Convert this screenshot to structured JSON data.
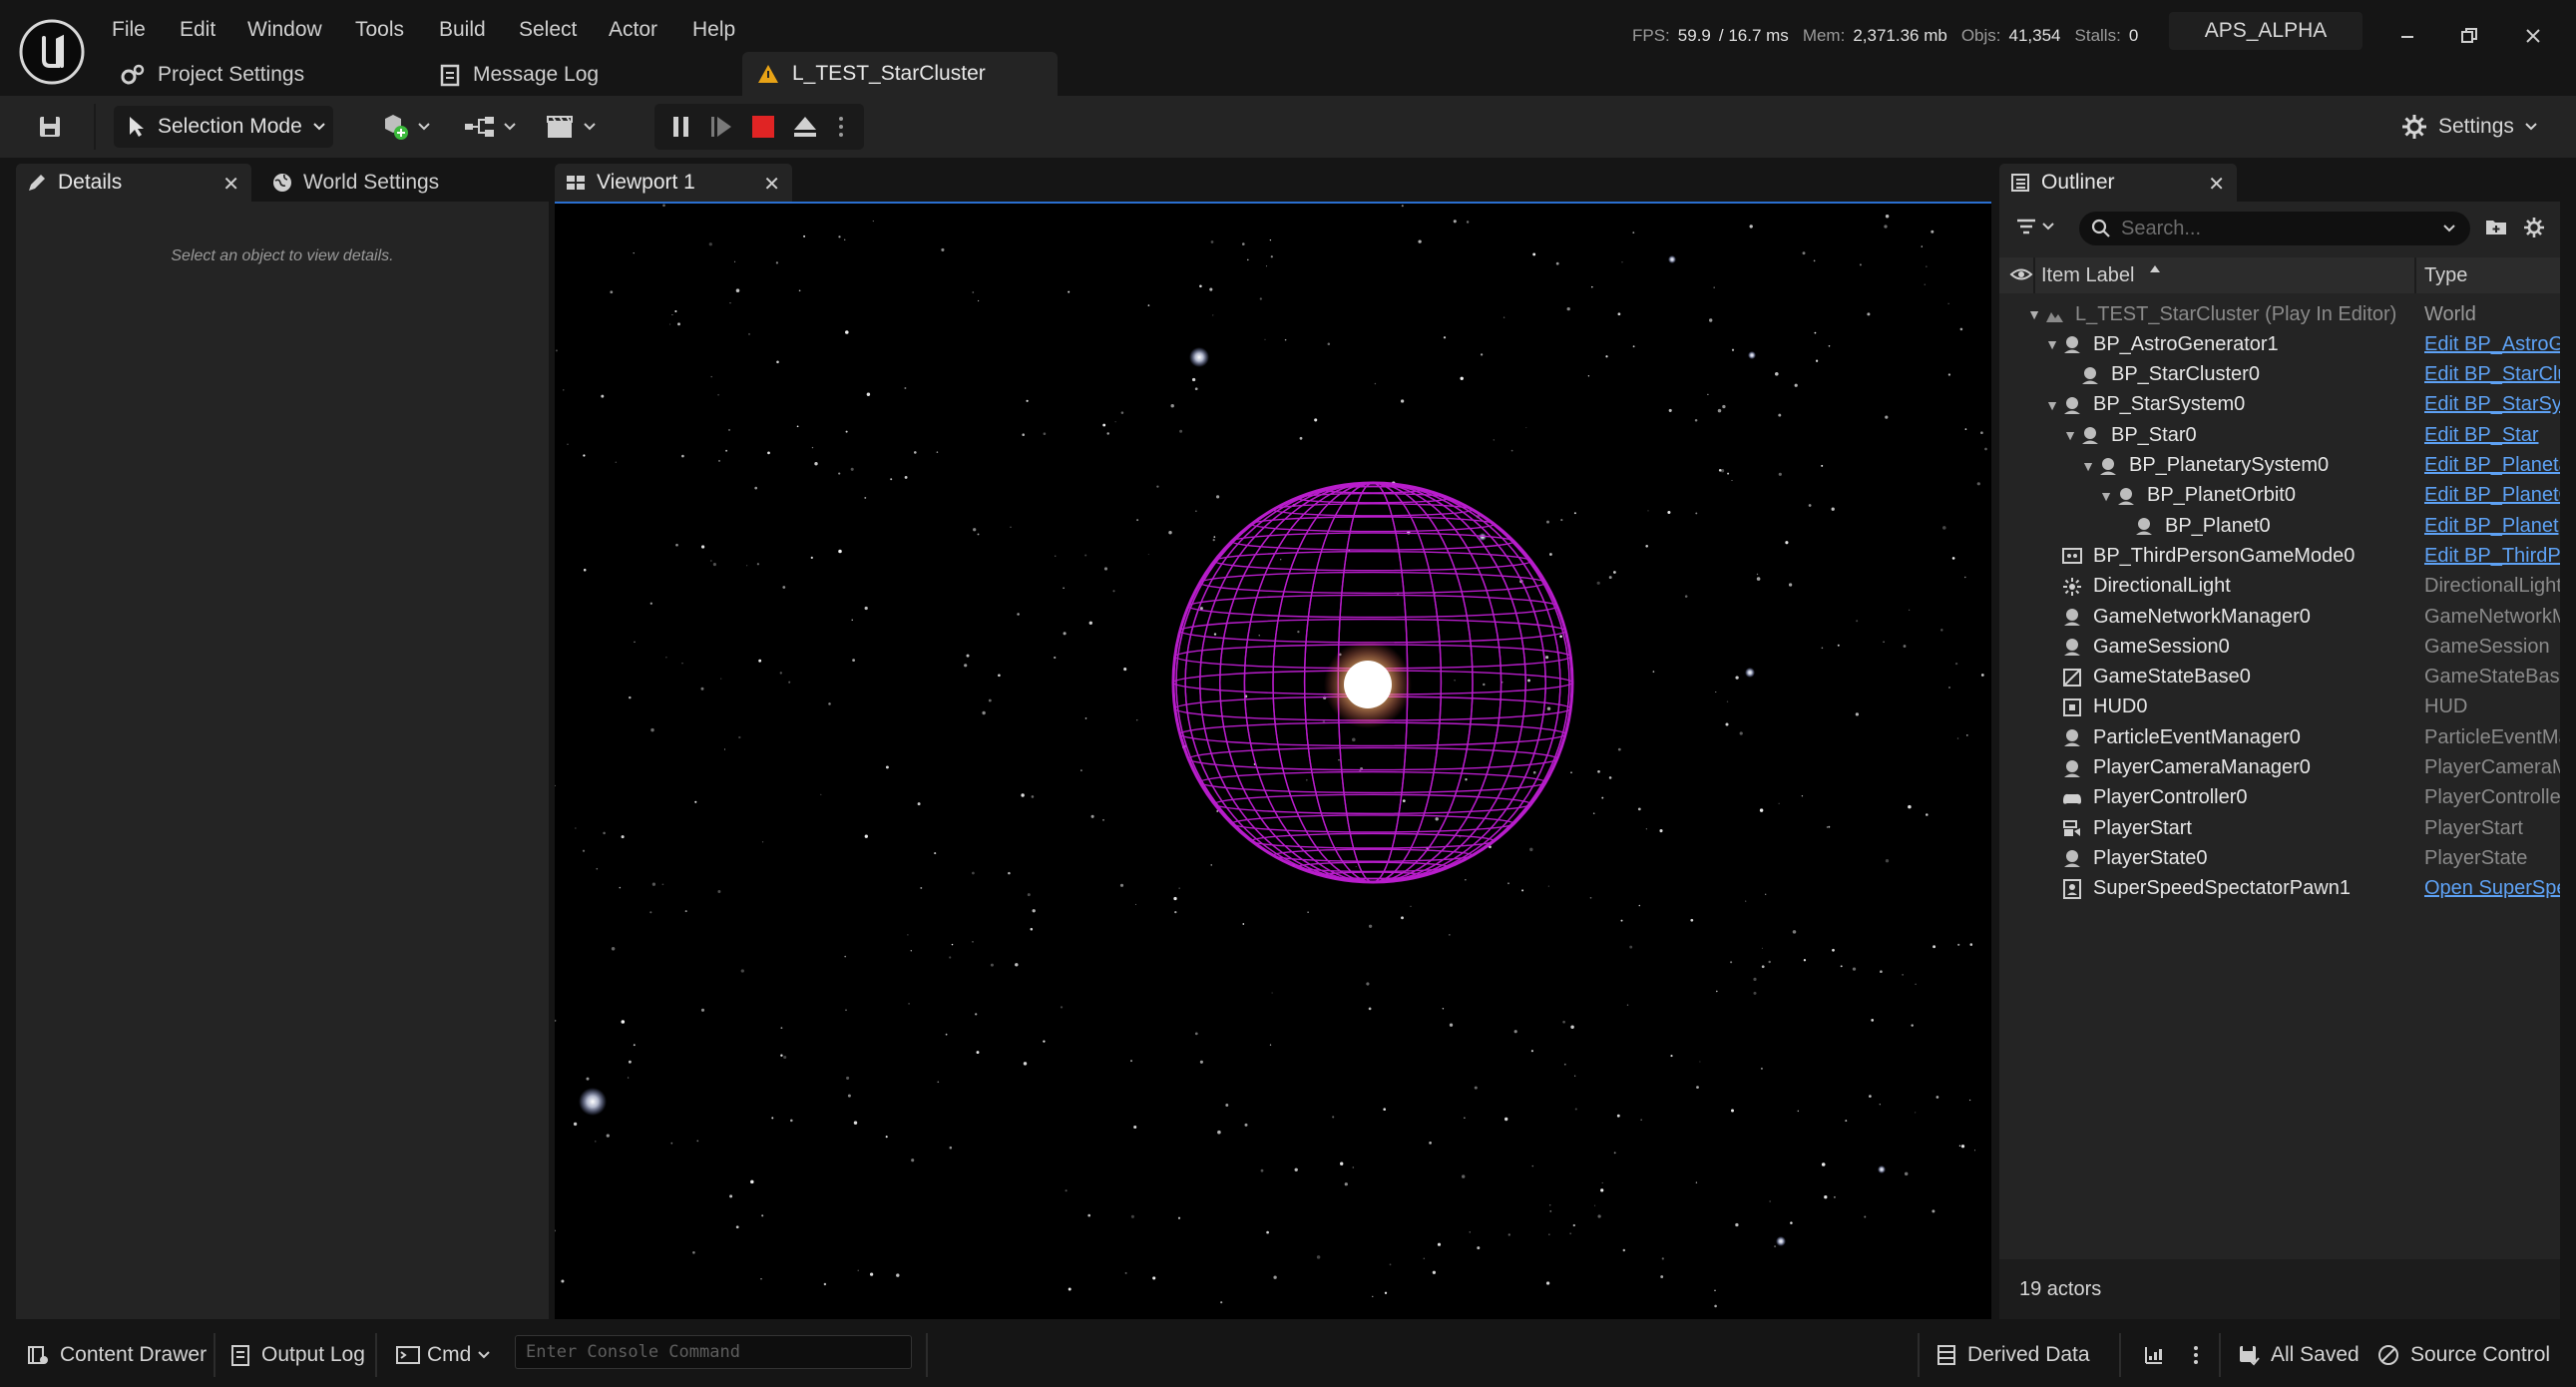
{
  "menu": [
    "File",
    "Edit",
    "Window",
    "Tools",
    "Build",
    "Select",
    "Actor",
    "Help"
  ],
  "subtabs": {
    "project_settings": "Project Settings",
    "message_log": "Message Log",
    "level": "L_TEST_StarCluster"
  },
  "stats": {
    "fps_label": "FPS:",
    "fps": "59.9",
    "ms": "/ 16.7 ms",
    "mem_label": "Mem:",
    "mem": "2,371.36 mb",
    "objs_label": "Objs:",
    "objs": "41,354",
    "stalls_label": "Stalls:",
    "stalls": "0"
  },
  "project_name": "APS_ALPHA",
  "toolbar": {
    "selection_mode": "Selection Mode",
    "settings": "Settings"
  },
  "tabs": {
    "details": "Details",
    "world_settings": "World Settings",
    "viewport": "Viewport 1",
    "outliner": "Outliner"
  },
  "details": {
    "empty_message": "Select an object to view details."
  },
  "outliner": {
    "search_placeholder": "Search...",
    "col_label": "Item Label",
    "col_type": "Type",
    "rows": [
      {
        "label": "L_TEST_StarCluster (Play In Editor)",
        "type": "World"
      },
      {
        "label": "BP_AstroGenerator1",
        "type": "Edit BP_AstroG"
      },
      {
        "label": "BP_StarCluster0",
        "type": "Edit BP_StarClu"
      },
      {
        "label": "BP_StarSystem0",
        "type": "Edit BP_StarSy"
      },
      {
        "label": "BP_Star0",
        "type": "Edit BP_Star"
      },
      {
        "label": "BP_PlanetarySystem0",
        "type": "Edit BP_Planeta"
      },
      {
        "label": "BP_PlanetOrbit0",
        "type": "Edit BP_PlanetO"
      },
      {
        "label": "BP_Planet0",
        "type": "Edit BP_Planet"
      },
      {
        "label": "BP_ThirdPersonGameMode0",
        "type": "Edit BP_ThirdP"
      },
      {
        "label": "DirectionalLight",
        "type": "DirectionalLight"
      },
      {
        "label": "GameNetworkManager0",
        "type": "GameNetworkM"
      },
      {
        "label": "GameSession0",
        "type": "GameSession"
      },
      {
        "label": "GameStateBase0",
        "type": "GameStateBase"
      },
      {
        "label": "HUD0",
        "type": "HUD"
      },
      {
        "label": "ParticleEventManager0",
        "type": "ParticleEventMa"
      },
      {
        "label": "PlayerCameraManager0",
        "type": "PlayerCameraM"
      },
      {
        "label": "PlayerController0",
        "type": "PlayerControlle"
      },
      {
        "label": "PlayerStart",
        "type": "PlayerStart"
      },
      {
        "label": "PlayerState0",
        "type": "PlayerState"
      },
      {
        "label": "SuperSpeedSpectatorPawn1",
        "type": "Open SuperSpe"
      }
    ],
    "footer": "19 actors"
  },
  "statusbar": {
    "content_drawer": "Content Drawer",
    "output_log": "Output Log",
    "cmd": "Cmd",
    "console_placeholder": "Enter Console Command",
    "derived_data": "Derived Data",
    "all_saved": "All Saved",
    "source_control": "Source Control"
  },
  "colors": {
    "accent_blue": "#2a6fd0",
    "link_blue": "#5ea2f5",
    "stop_red": "#e02424",
    "wireframe_magenta": "#c21fd6",
    "warning_orange": "#e8a316"
  }
}
